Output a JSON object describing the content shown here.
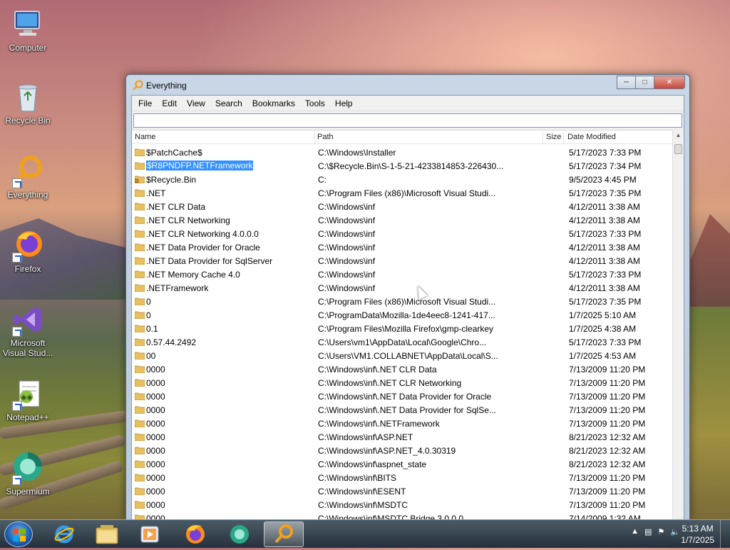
{
  "desktop": {
    "icons": [
      {
        "label": "Computer",
        "icon": "computer-icon"
      },
      {
        "label": "Recycle Bin",
        "icon": "recycle-bin-icon"
      },
      {
        "label": "Everything",
        "icon": "everything-icon"
      },
      {
        "label": "Firefox",
        "icon": "firefox-icon"
      },
      {
        "label": "Microsoft Visual Stud...",
        "icon": "visual-studio-icon"
      },
      {
        "label": "Notepad++",
        "icon": "notepad-plus-plus-icon"
      },
      {
        "label": "Supermium",
        "icon": "supermium-icon"
      }
    ]
  },
  "window": {
    "title": "Everything",
    "menu": [
      "File",
      "Edit",
      "View",
      "Search",
      "Bookmarks",
      "Tools",
      "Help"
    ],
    "search_value": "",
    "columns": {
      "name": "Name",
      "path": "Path",
      "size": "Size",
      "date": "Date Modified"
    },
    "rows": [
      {
        "name": "$PatchCache$",
        "path": "C:\\Windows\\Installer",
        "date": "5/17/2023 7:33 PM",
        "icon": "folder-icon"
      },
      {
        "name": "$R8PNDFP.NETFramework",
        "path": "C:\\$Recycle.Bin\\S-1-5-21-4233814853-226430...",
        "date": "5/17/2023 7:34 PM",
        "icon": "folder-icon",
        "selected": true
      },
      {
        "name": "$Recycle.Bin",
        "path": "C:",
        "date": "9/5/2023 4:45 PM",
        "icon": "locked-folder-icon"
      },
      {
        "name": ".NET",
        "path": "C:\\Program Files (x86)\\Microsoft Visual Studi...",
        "date": "5/17/2023 7:35 PM",
        "icon": "folder-icon"
      },
      {
        "name": ".NET CLR Data",
        "path": "C:\\Windows\\inf",
        "date": "4/12/2011 3:38 AM",
        "icon": "folder-icon"
      },
      {
        "name": ".NET CLR Networking",
        "path": "C:\\Windows\\inf",
        "date": "4/12/2011 3:38 AM",
        "icon": "folder-icon"
      },
      {
        "name": ".NET CLR Networking 4.0.0.0",
        "path": "C:\\Windows\\inf",
        "date": "5/17/2023 7:33 PM",
        "icon": "folder-icon"
      },
      {
        "name": ".NET Data Provider for Oracle",
        "path": "C:\\Windows\\inf",
        "date": "4/12/2011 3:38 AM",
        "icon": "folder-icon"
      },
      {
        "name": ".NET Data Provider for SqlServer",
        "path": "C:\\Windows\\inf",
        "date": "4/12/2011 3:38 AM",
        "icon": "folder-icon"
      },
      {
        "name": ".NET Memory Cache 4.0",
        "path": "C:\\Windows\\inf",
        "date": "5/17/2023 7:33 PM",
        "icon": "folder-icon"
      },
      {
        "name": ".NETFramework",
        "path": "C:\\Windows\\inf",
        "date": "4/12/2011 3:38 AM",
        "icon": "folder-icon"
      },
      {
        "name": "0",
        "path": "C:\\Program Files (x86)\\Microsoft Visual Studi...",
        "date": "5/17/2023 7:35 PM",
        "icon": "folder-icon"
      },
      {
        "name": "0",
        "path": "C:\\ProgramData\\Mozilla-1de4eec8-1241-417...",
        "date": "1/7/2025 5:10 AM",
        "icon": "folder-icon"
      },
      {
        "name": "0.1",
        "path": "C:\\Program Files\\Mozilla Firefox\\gmp-clearkey",
        "date": "1/7/2025 4:38 AM",
        "icon": "folder-icon"
      },
      {
        "name": "0.57.44.2492",
        "path": "C:\\Users\\vm1\\AppData\\Local\\Google\\Chro...",
        "date": "5/17/2023 7:33 PM",
        "icon": "folder-icon"
      },
      {
        "name": "00",
        "path": "C:\\Users\\VM1.COLLABNET\\AppData\\Local\\S...",
        "date": "1/7/2025 4:53 AM",
        "icon": "folder-icon"
      },
      {
        "name": "0000",
        "path": "C:\\Windows\\inf\\.NET CLR Data",
        "date": "7/13/2009 11:20 PM",
        "icon": "folder-icon"
      },
      {
        "name": "0000",
        "path": "C:\\Windows\\inf\\.NET CLR Networking",
        "date": "7/13/2009 11:20 PM",
        "icon": "folder-icon"
      },
      {
        "name": "0000",
        "path": "C:\\Windows\\inf\\.NET Data Provider for Oracle",
        "date": "7/13/2009 11:20 PM",
        "icon": "folder-icon"
      },
      {
        "name": "0000",
        "path": "C:\\Windows\\inf\\.NET Data Provider for SqlSe...",
        "date": "7/13/2009 11:20 PM",
        "icon": "folder-icon"
      },
      {
        "name": "0000",
        "path": "C:\\Windows\\inf\\.NETFramework",
        "date": "7/13/2009 11:20 PM",
        "icon": "folder-icon"
      },
      {
        "name": "0000",
        "path": "C:\\Windows\\inf\\ASP.NET",
        "date": "8/21/2023 12:32 AM",
        "icon": "folder-icon"
      },
      {
        "name": "0000",
        "path": "C:\\Windows\\inf\\ASP.NET_4.0.30319",
        "date": "8/21/2023 12:32 AM",
        "icon": "folder-icon"
      },
      {
        "name": "0000",
        "path": "C:\\Windows\\inf\\aspnet_state",
        "date": "8/21/2023 12:32 AM",
        "icon": "folder-icon"
      },
      {
        "name": "0000",
        "path": "C:\\Windows\\inf\\BITS",
        "date": "7/13/2009 11:20 PM",
        "icon": "folder-icon"
      },
      {
        "name": "0000",
        "path": "C:\\Windows\\inf\\ESENT",
        "date": "7/13/2009 11:20 PM",
        "icon": "folder-icon"
      },
      {
        "name": "0000",
        "path": "C:\\Windows\\inf\\MSDTC",
        "date": "7/13/2009 11:20 PM",
        "icon": "folder-icon"
      },
      {
        "name": "0000",
        "path": "C:\\Windows\\inf\\MSDTC Bridge 3.0.0.0",
        "date": "7/14/2009 1:32 AM",
        "icon": "folder-icon"
      }
    ]
  },
  "taskbar": {
    "apps": [
      "start-orb-icon",
      "internet-explorer-icon",
      "file-explorer-icon",
      "media-player-icon",
      "firefox-icon",
      "supermium-icon",
      "everything-icon"
    ],
    "active_app": "everything-icon",
    "time": "5:13 AM",
    "date": "1/7/2025",
    "tray_icons": [
      "show-hidden-icons-icon",
      "network-icon",
      "action-center-flag-icon",
      "volume-muted-icon"
    ]
  },
  "colors": {
    "selection": "#3390ff",
    "accent": "#f0a020"
  }
}
